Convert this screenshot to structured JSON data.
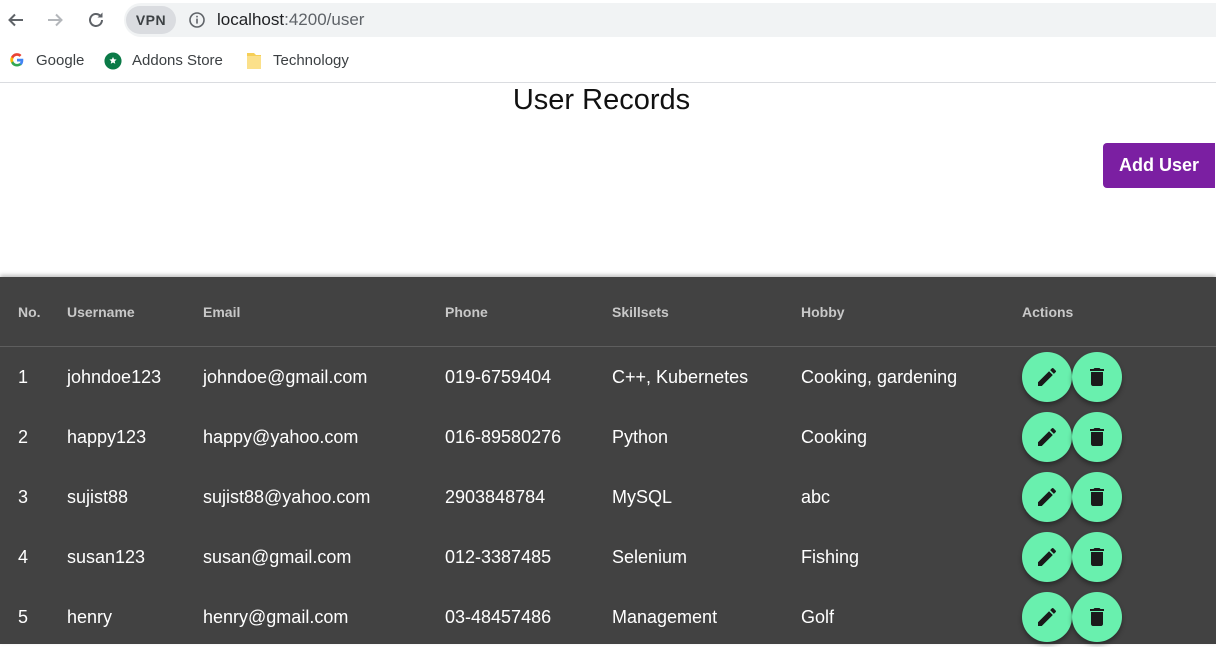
{
  "browser": {
    "vpn_label": "VPN",
    "url_host": "localhost",
    "url_path": ":4200/user",
    "bookmarks": [
      {
        "label": "Google",
        "icon": "google-icon"
      },
      {
        "label": "Addons Store",
        "icon": "addons-store-icon"
      },
      {
        "label": "Technology",
        "icon": "folder-icon"
      }
    ]
  },
  "page": {
    "title": "User Records",
    "add_button": "Add User"
  },
  "table": {
    "headers": [
      "No.",
      "Username",
      "Email",
      "Phone",
      "Skillsets",
      "Hobby",
      "Actions"
    ],
    "rows": [
      {
        "no": "1",
        "username": "johndoe123",
        "email": "johndoe@gmail.com",
        "phone": "019-6759404",
        "skillsets": "C++, Kubernetes",
        "hobby": "Cooking, gardening"
      },
      {
        "no": "2",
        "username": "happy123",
        "email": "happy@yahoo.com",
        "phone": "016-89580276",
        "skillsets": "Python",
        "hobby": "Cooking"
      },
      {
        "no": "3",
        "username": "sujist88",
        "email": "sujist88@yahoo.com",
        "phone": "2903848784",
        "skillsets": "MySQL",
        "hobby": "abc"
      },
      {
        "no": "4",
        "username": "susan123",
        "email": "susan@gmail.com",
        "phone": "012-3387485",
        "skillsets": "Selenium",
        "hobby": "Fishing"
      },
      {
        "no": "5",
        "username": "henry",
        "email": "henry@gmail.com",
        "phone": "03-48457486",
        "skillsets": "Management",
        "hobby": "Golf"
      }
    ]
  },
  "colors": {
    "accent_purple": "#7b1fa2",
    "fab_green": "#69f0ae",
    "table_bg": "#424242"
  }
}
